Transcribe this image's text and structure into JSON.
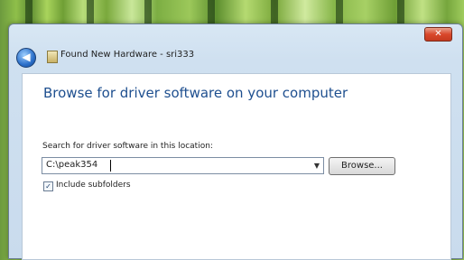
{
  "window": {
    "title": "Found New Hardware - sri333",
    "close_glyph": "✕",
    "back_glyph": "◀"
  },
  "content": {
    "heading": "Browse for driver software on your computer",
    "search_label": "Search for driver software in this location:",
    "path_value": "C:\\peak354",
    "combo_arrow": "▼",
    "browse_label": "Browse...",
    "include_subfolders_label": "Include subfolders",
    "include_subfolders_checked": true,
    "check_glyph": "✓"
  },
  "icons": [
    "back-arrow-icon",
    "hardware-icon",
    "close-icon",
    "dropdown-arrow-icon",
    "checkmark-icon"
  ]
}
